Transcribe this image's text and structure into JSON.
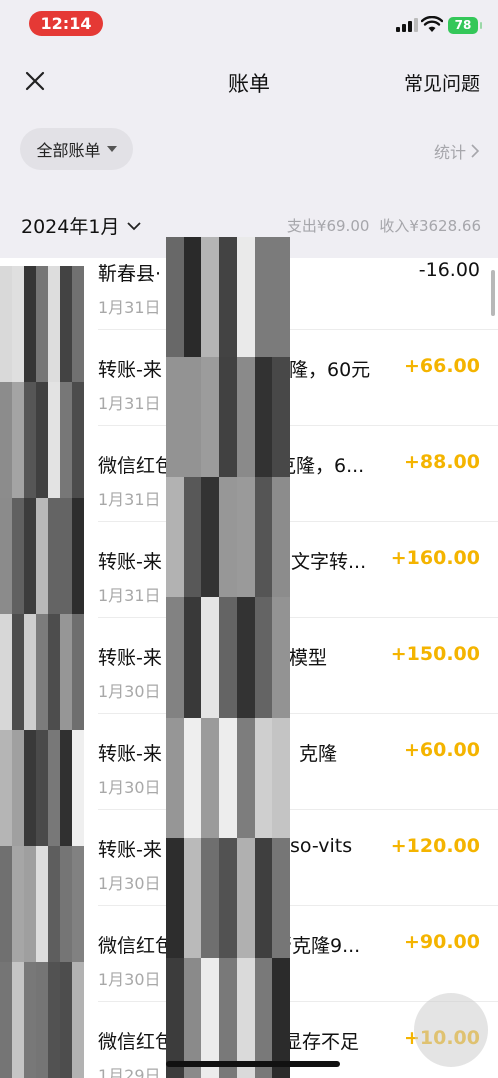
{
  "status_bar": {
    "time": "12:14",
    "battery": "78"
  },
  "nav": {
    "title": "账单",
    "faq": "常见问题"
  },
  "filter": {
    "label": "全部账单",
    "stats": "统计"
  },
  "month": {
    "label": "2024年1月",
    "expense": "支出¥69.00",
    "income": "收入¥3628.66"
  },
  "transactions": [
    {
      "title": "靳春县·",
      "date": "1月31日 1",
      "amount": "-16.00",
      "type": "expense"
    },
    {
      "title": "转账-来",
      "title_tail": "隆，60元",
      "date": "1月31日",
      "amount": "+66.00",
      "type": "income"
    },
    {
      "title": "微信红包",
      "title_tail": "克隆，6...",
      "date": "1月31日",
      "amount": "+88.00",
      "type": "income"
    },
    {
      "title": "转账-来",
      "title_tail": "文字转...",
      "date": "1月31日",
      "amount": "+160.00",
      "type": "income"
    },
    {
      "title": "转账-来",
      "title_tail": "模型",
      "date": "1月30日",
      "amount": "+150.00",
      "type": "income"
    },
    {
      "title": "转账-来",
      "title_tail": "克隆",
      "date": "1月30日",
      "amount": "+60.00",
      "type": "income"
    },
    {
      "title": "转账-来",
      "title_tail": "so-vits",
      "date": "1月30日",
      "amount": "+120.00",
      "type": "income"
    },
    {
      "title": "微信红包",
      "title_tail": "帮克隆9...",
      "date": "1月30日",
      "amount": "+90.00",
      "type": "income"
    },
    {
      "title": "微信红包",
      "title_tail": "显存不足",
      "date": "1月29日",
      "amount": "+10.00",
      "type": "income"
    }
  ],
  "colors": {
    "income": "#f4b400",
    "background": "#efeef3",
    "accent_red": "#e53935",
    "battery": "#34c759"
  }
}
